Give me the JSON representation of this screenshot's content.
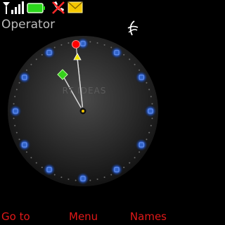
{
  "status_bar": {
    "signal_icon": "signal-bars-icon",
    "battery_icon": "battery-full-icon",
    "silent_icon": "silent-profile-icon",
    "message_icon": "envelope-icon"
  },
  "operator_name": "Operator",
  "watermark": "RT IDEAS",
  "softkeys": {
    "left": "Go to",
    "center": "Menu",
    "right": "Names"
  },
  "colors": {
    "softkey": "#e01818",
    "hour_markers": "#2f62c9",
    "second_marker": "#ff0000",
    "hour_marker_green": "#35d11b",
    "minute_marker_yellow": "#f2e800"
  }
}
